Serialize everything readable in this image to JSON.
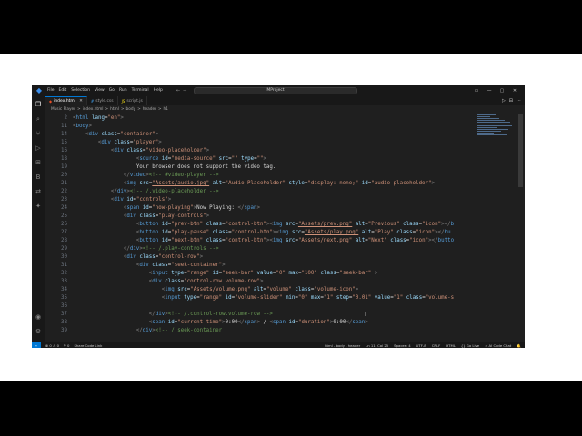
{
  "titlebar": {
    "menu": [
      "File",
      "Edit",
      "Selection",
      "View",
      "Go",
      "Run",
      "Terminal",
      "Help"
    ],
    "search": "MProject",
    "nav_back": "←",
    "nav_forward": "→",
    "window_controls": [
      "▭",
      "—",
      "▢",
      "✕"
    ]
  },
  "tabs": [
    {
      "label": "index.html",
      "icon": "html-file-icon",
      "active": true,
      "close": "✕"
    },
    {
      "label": "style.css",
      "icon": "css-file-icon",
      "active": false
    },
    {
      "label": "script.js",
      "icon": "js-file-icon",
      "active": false
    }
  ],
  "editor_actions": [
    "▷",
    "⊟",
    "⋯"
  ],
  "breadcrumb": [
    "Music Player",
    ">",
    "index.html",
    ">",
    "html",
    ">",
    "body",
    ">",
    "header",
    ">",
    "h1"
  ],
  "code_lines": [
    {
      "n": "2"
    },
    {
      "n": "11"
    },
    {
      "n": "14"
    },
    {
      "n": "15"
    },
    {
      "n": "16"
    },
    {
      "n": "18"
    },
    {
      "n": "19"
    },
    {
      "n": "20"
    },
    {
      "n": "21"
    },
    {
      "n": "22"
    },
    {
      "n": "23"
    },
    {
      "n": "24"
    },
    {
      "n": "25"
    },
    {
      "n": "26"
    },
    {
      "n": "27"
    },
    {
      "n": "28"
    },
    {
      "n": "29"
    },
    {
      "n": "30"
    },
    {
      "n": "31"
    },
    {
      "n": "32"
    },
    {
      "n": "33"
    },
    {
      "n": "34"
    },
    {
      "n": "35"
    },
    {
      "n": "36"
    },
    {
      "n": "37"
    },
    {
      "n": "38"
    },
    {
      "n": "39"
    }
  ],
  "statusbar": {
    "left": [
      "⊗ 0 ⚠ 0",
      "⚲ 0",
      "Share Code Link"
    ],
    "right": [
      "html - body - header",
      "Ln 11, Col 25",
      "Spaces: 4",
      "UTF-8",
      "CRLF",
      "HTML",
      "{} Go Live",
      "✓ AI Code Chat",
      "🔔"
    ]
  },
  "colors": {
    "accent": "#0078d4",
    "editor_bg": "#1f1f1f",
    "chrome_bg": "#181818"
  }
}
